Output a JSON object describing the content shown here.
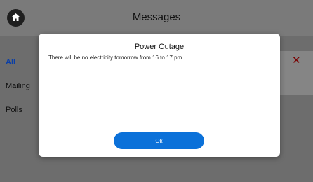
{
  "header": {
    "title": "Messages",
    "home_icon": "home-icon"
  },
  "sidebar": {
    "items": [
      {
        "label": "All",
        "active": true
      },
      {
        "label": "Mailing",
        "active": false
      },
      {
        "label": "Polls",
        "active": false
      }
    ]
  },
  "message_card": {
    "delete_icon": "close-icon"
  },
  "dialog": {
    "title": "Power Outage",
    "body": "There will be no electricity tomorrow from 16 to 17 pm.",
    "ok_label": "Ok"
  },
  "colors": {
    "accent": "#0b71d9",
    "active_tab": "#0a3fa8",
    "delete": "#7a0000"
  }
}
